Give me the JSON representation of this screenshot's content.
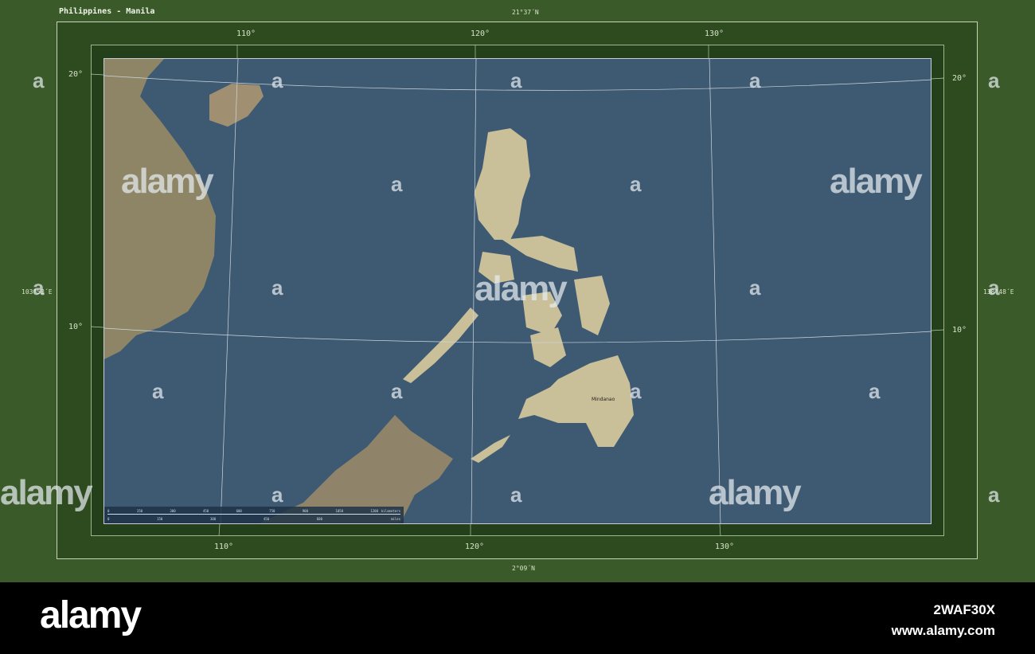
{
  "title": "Philippines - Manila",
  "bounds": {
    "north": "21°37´N",
    "south": "2°09´N",
    "west": "103°53´E",
    "east": "138°48´E"
  },
  "lon_ticks": [
    "110°",
    "120°",
    "130°"
  ],
  "lat_ticks": [
    "20°",
    "10°"
  ],
  "place_label": "Mindanao",
  "scale": {
    "km_ticks": [
      "0",
      "150",
      "300",
      "450",
      "600",
      "750",
      "900",
      "1050",
      "1200"
    ],
    "km_unit": "kilometers",
    "mi_ticks": [
      "0",
      "150",
      "300",
      "450",
      "600"
    ],
    "mi_unit": "miles"
  },
  "watermark": {
    "text": "alamy",
    "letter": "a"
  },
  "footer": {
    "logo": "alamy",
    "image_id": "2WAF30X",
    "url": "www.alamy.com"
  },
  "colors": {
    "sea": "#3e5a72",
    "land": "#b9b08a",
    "frame": "#3b5a29"
  }
}
